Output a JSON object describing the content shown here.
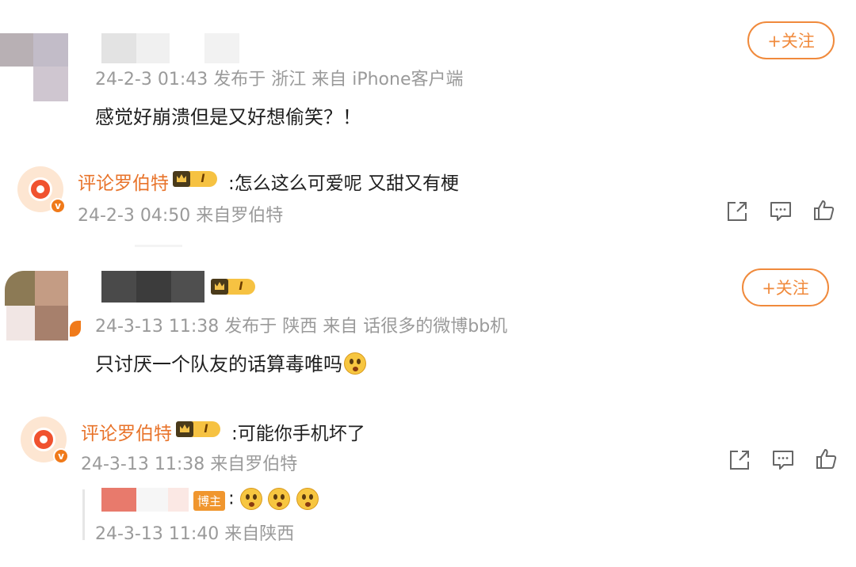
{
  "comments": [
    {
      "meta": "24-2-3 01:43 发布于 浙江 来自 iPhone客户端",
      "text": "感觉好崩溃但是又好想偷笑？！",
      "follow_label": "+关注",
      "reply": {
        "author": "评论罗伯特",
        "crown_level": "I",
        "text": ":怎么这么可爱呢 又甜又有梗",
        "meta": "24-2-3 04:50 来自罗伯特"
      }
    },
    {
      "meta": "24-3-13 11:38 发布于 陕西 来自 话很多的微博bb机",
      "text": "只讨厌一个队友的话算毒唯吗",
      "follow_label": "+关注",
      "crown_level": "I",
      "reply": {
        "author": "评论罗伯特",
        "crown_level": "I",
        "text": ":可能你手机坏了",
        "meta": "24-3-13 11:38 来自罗伯特"
      },
      "sub_reply": {
        "badge": "博主",
        "text": ":",
        "meta": "24-3-13 11:40 来自陕西"
      }
    }
  ],
  "icons": {
    "share": "share-icon",
    "comment": "comment-icon",
    "like": "like-icon",
    "emoji": "wondering-emoji-icon",
    "avatar_badge": "v"
  },
  "colors": {
    "accent": "#f08a3c",
    "username": "#e8732a",
    "meta": "#9a9a9a"
  }
}
